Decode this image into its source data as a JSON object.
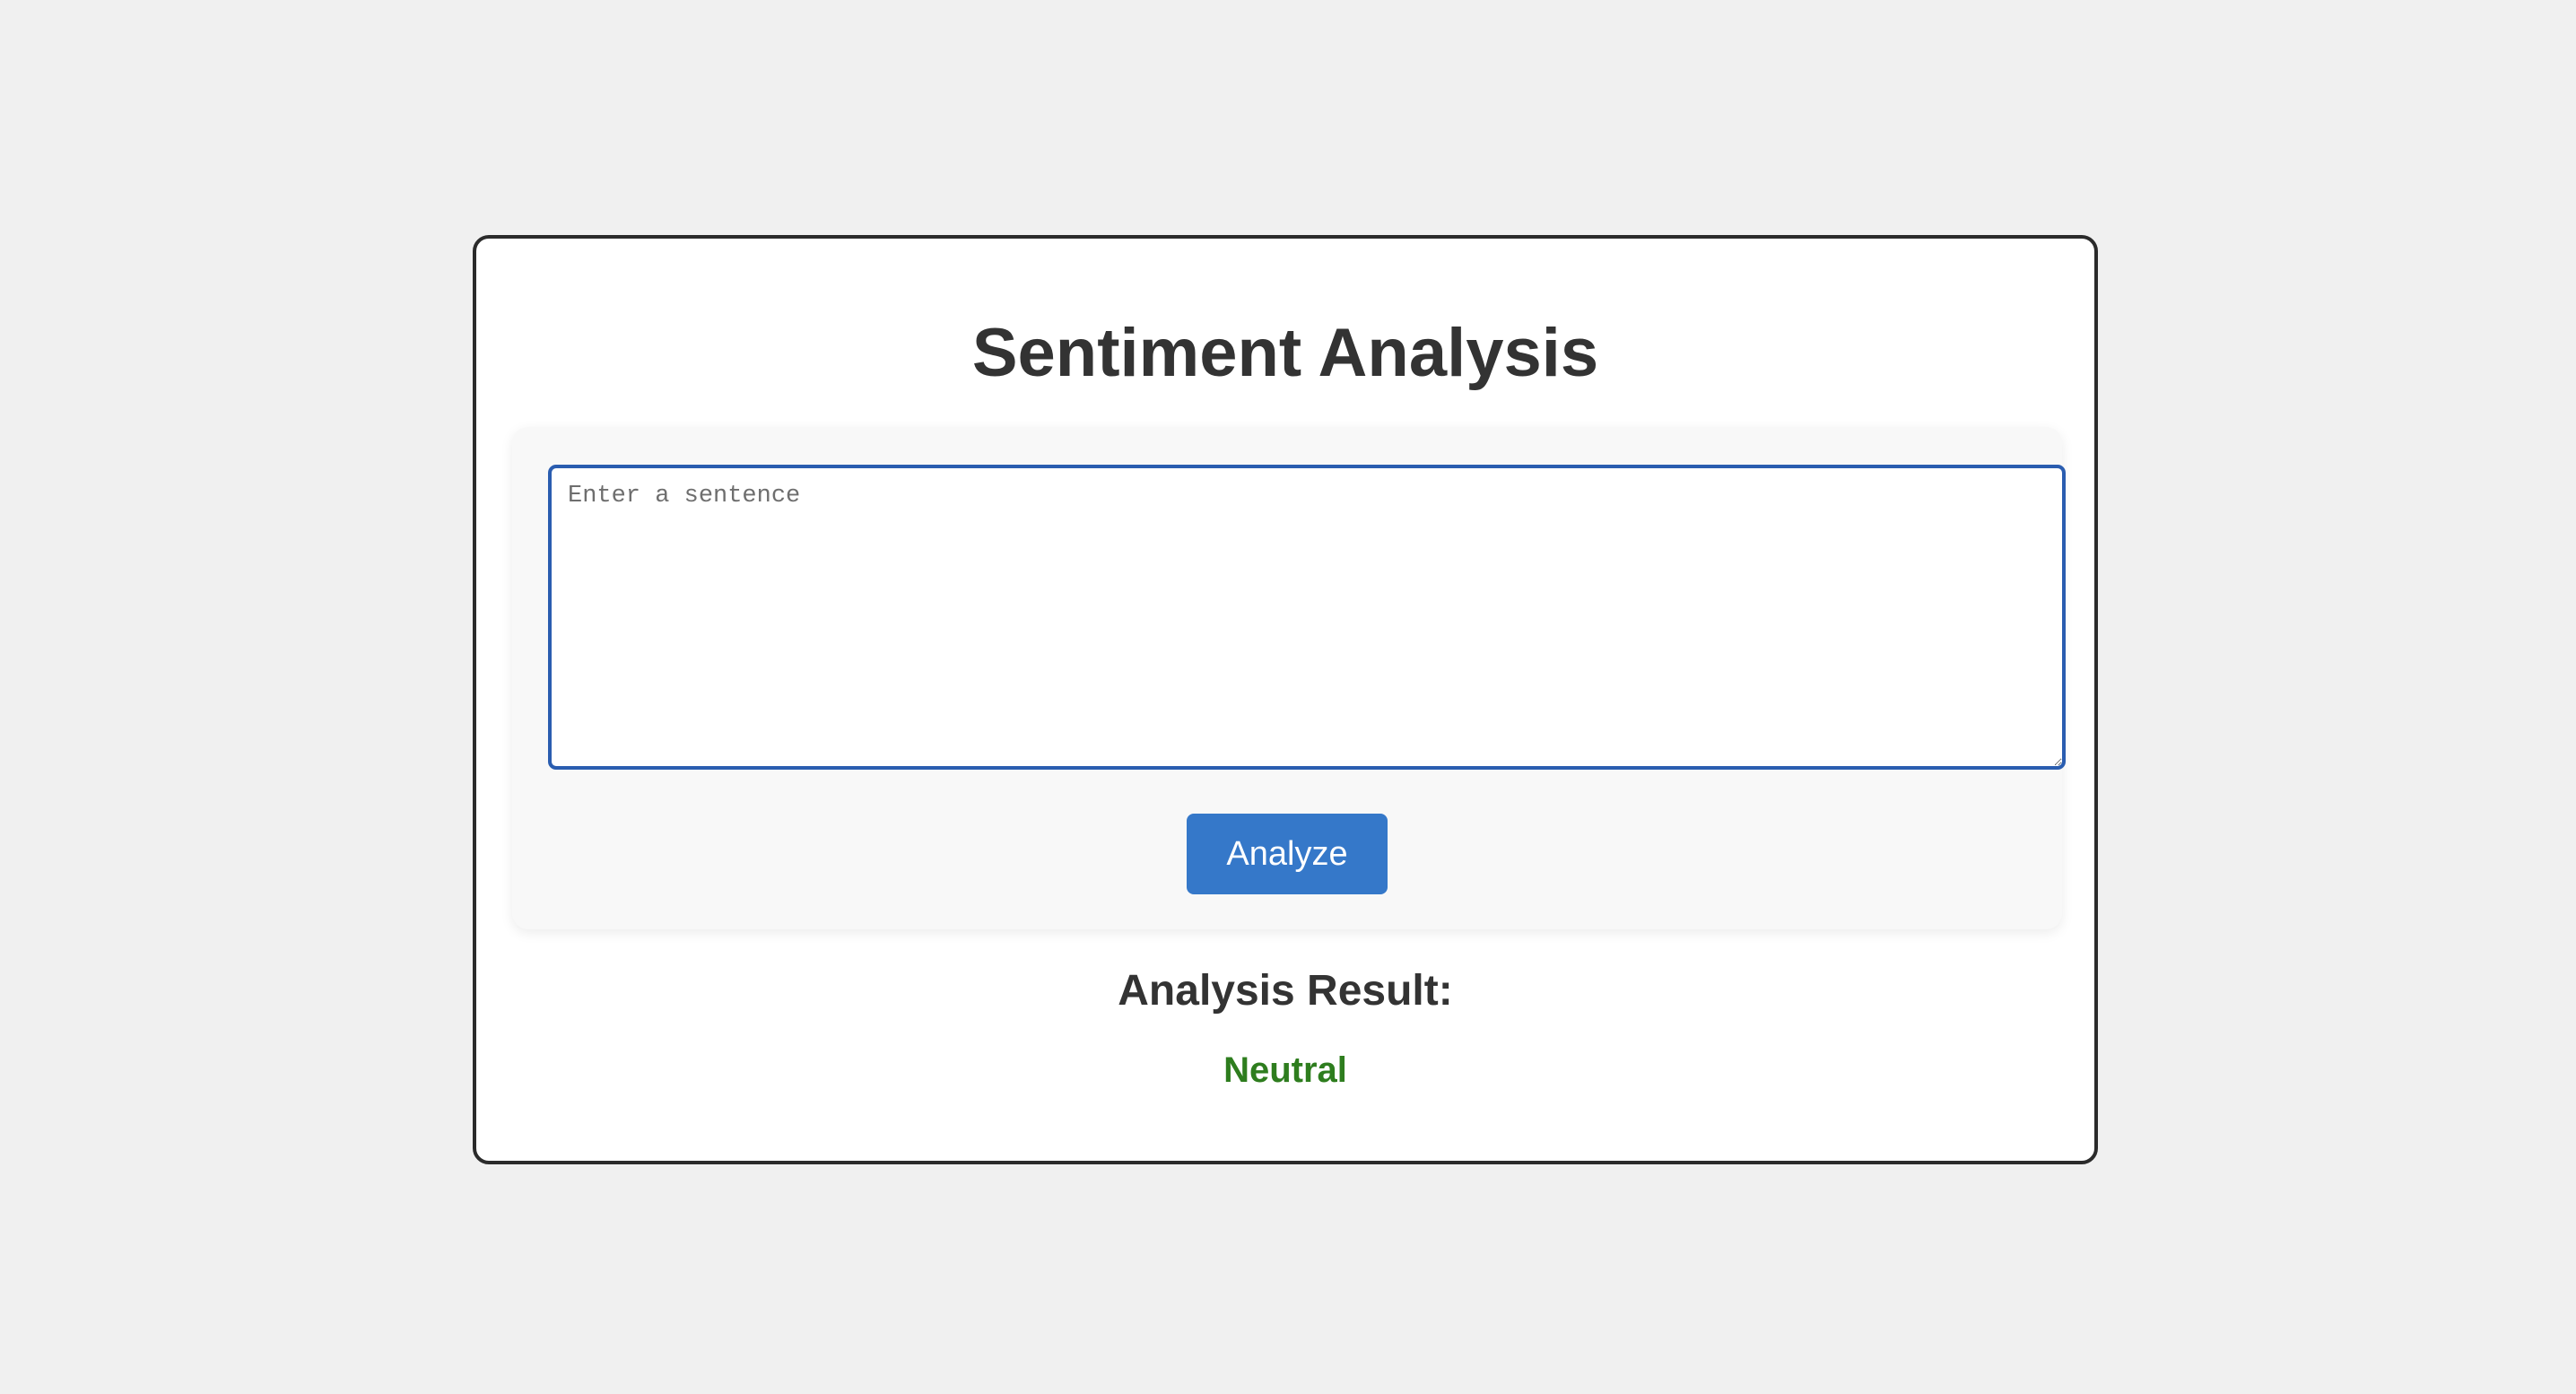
{
  "app": {
    "title": "Sentiment Analysis"
  },
  "input": {
    "placeholder": "Enter a sentence",
    "value": ""
  },
  "actions": {
    "analyze_label": "Analyze"
  },
  "result": {
    "heading": "Analysis Result:",
    "sentiment": "Neutral",
    "sentiment_color": "#2e7d1e"
  },
  "colors": {
    "accent": "#3578c9",
    "focus_border": "#2a5db0",
    "text": "#333333",
    "background": "#f0f0f0"
  }
}
